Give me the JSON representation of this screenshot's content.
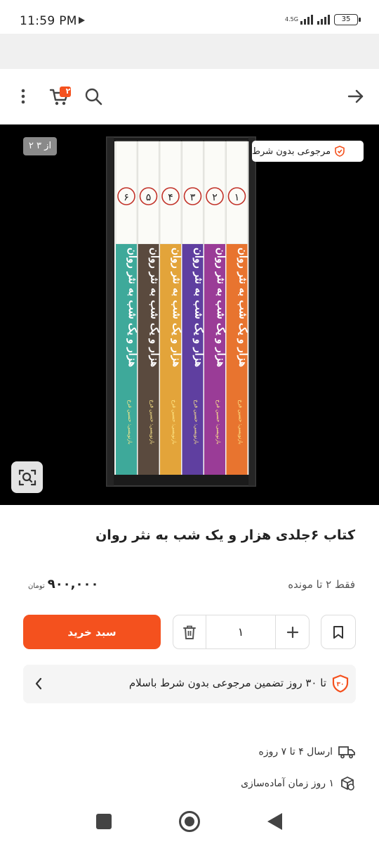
{
  "status": {
    "time": "11:59 PM",
    "network": "4.5G",
    "battery": "35"
  },
  "hero": {
    "counter": "۲ از ۳",
    "return_badge": "مرجوعی بدون شرط"
  },
  "cart_badge": "۲",
  "product": {
    "title": "کتاب ۶جلدی هزار و یک شب به نثر روان",
    "stock": "فقط ۲ تا مونده",
    "price": "۹۰۰,۰۰۰",
    "currency": "تومان"
  },
  "actions": {
    "add_to_cart": "سبد خرید",
    "quantity": "۱"
  },
  "guarantee": {
    "text": "تا ۳۰ روز تضمین مرجوعی بدون شرط باسلام",
    "badge_number": "۳۰"
  },
  "shipping": {
    "delivery": "ارسال ۴ تا ۷ روزه",
    "prep": "۱ روز زمان آماده‌سازی"
  },
  "books": {
    "title": "هزار و یک شب",
    "subtitle": "به نثر روان",
    "author": "بازنویسی: حسین فرخ",
    "volumes": [
      {
        "num": "۶",
        "color": "#3ea99a"
      },
      {
        "num": "۵",
        "color": "#5a4a3e"
      },
      {
        "num": "۴",
        "color": "#e3a43a"
      },
      {
        "num": "۳",
        "color": "#5f3fa0"
      },
      {
        "num": "۲",
        "color": "#9a3c97"
      },
      {
        "num": "۱",
        "color": "#e8742f"
      }
    ]
  },
  "colors": {
    "accent": "#f4511e",
    "hero_bg": "#000000"
  }
}
